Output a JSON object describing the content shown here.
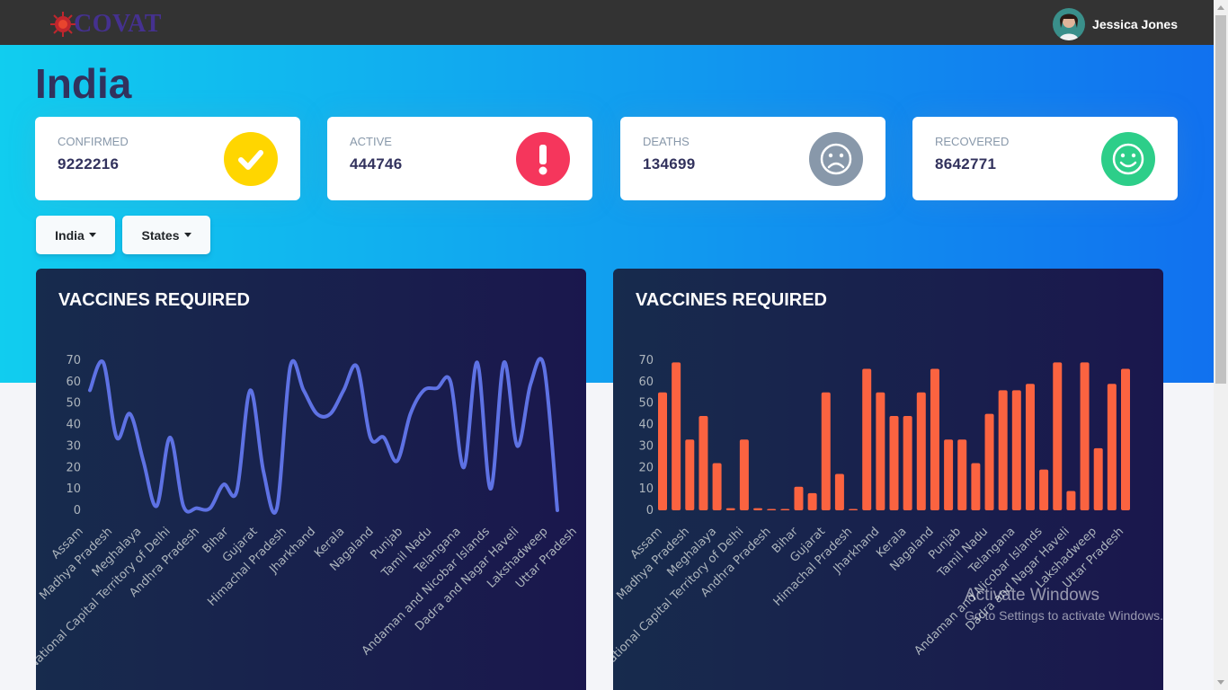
{
  "app": {
    "logo_text": "COVAT"
  },
  "user": {
    "name": "Jessica Jones"
  },
  "page": {
    "title": "India"
  },
  "stats": [
    {
      "label": "CONFIRMED",
      "value": "9222216",
      "icon": "check-icon",
      "color": "#ffd600"
    },
    {
      "label": "ACTIVE",
      "value": "444746",
      "icon": "exclamation-icon",
      "color": "#f5365c"
    },
    {
      "label": "DEATHS",
      "value": "134699",
      "icon": "sad-face-icon",
      "color": "#8898aa"
    },
    {
      "label": "RECOVERED",
      "value": "8642771",
      "icon": "smile-face-icon",
      "color": "#2dce89"
    }
  ],
  "filters": {
    "country_label": "India",
    "states_label": "States"
  },
  "charts": {
    "line_title": "VACCINES REQUIRED",
    "bar_title": "VACCINES REQUIRED"
  },
  "watermark": {
    "line1": "Activate Windows",
    "line2": "Go to Settings to activate Windows."
  },
  "chart_data": [
    {
      "type": "line",
      "title": "VACCINES REQUIRED",
      "color": "#5e72e4",
      "ylim": [
        0,
        70
      ],
      "yticks": [
        0,
        10,
        20,
        30,
        40,
        50,
        60,
        70
      ],
      "xlabels": [
        "Assam",
        "Madhya Pradesh",
        "Meghalaya",
        "National Capital Territory of Delhi",
        "Andhra Pradesh",
        "Bihar",
        "Gujarat",
        "Himachal Pradesh",
        "Jharkhand",
        "Kerala",
        "Nagaland",
        "Punjab",
        "Tamil Nadu",
        "Telangana",
        "Andaman and Nicobar Islands",
        "Dadra and Nagar Haveli",
        "Lakshadweep",
        "Uttar Pradesh"
      ],
      "values": [
        56,
        69,
        34,
        45,
        23,
        2,
        34,
        2,
        1,
        1,
        12,
        9,
        56,
        18,
        1,
        67,
        56,
        45,
        45,
        56,
        67,
        34,
        34,
        23,
        45,
        56,
        57,
        60,
        20,
        69,
        10,
        69,
        30,
        59,
        67,
        0
      ]
    },
    {
      "type": "bar",
      "title": "VACCINES REQUIRED",
      "color": "#fb6340",
      "ylim": [
        0,
        70
      ],
      "yticks": [
        0,
        10,
        20,
        30,
        40,
        50,
        60,
        70
      ],
      "xlabels": [
        "Assam",
        "Madhya Pradesh",
        "Meghalaya",
        "National Capital Territory of Delhi",
        "Andhra Pradesh",
        "Bihar",
        "Gujarat",
        "Himachal Pradesh",
        "Jharkhand",
        "Kerala",
        "Nagaland",
        "Punjab",
        "Tamil Nadu",
        "Telangana",
        "Andaman and Nicobar Islands",
        "Dadra and Nagar Haveli",
        "Lakshadweep",
        "Uttar Pradesh"
      ],
      "values": [
        55,
        69,
        33,
        44,
        22,
        1,
        33,
        1,
        0.5,
        0.5,
        11,
        8,
        55,
        17,
        0.5,
        66,
        55,
        44,
        44,
        55,
        66,
        33,
        33,
        22,
        45,
        56,
        56,
        59,
        19,
        69,
        9,
        69,
        29,
        59,
        66
      ]
    }
  ]
}
